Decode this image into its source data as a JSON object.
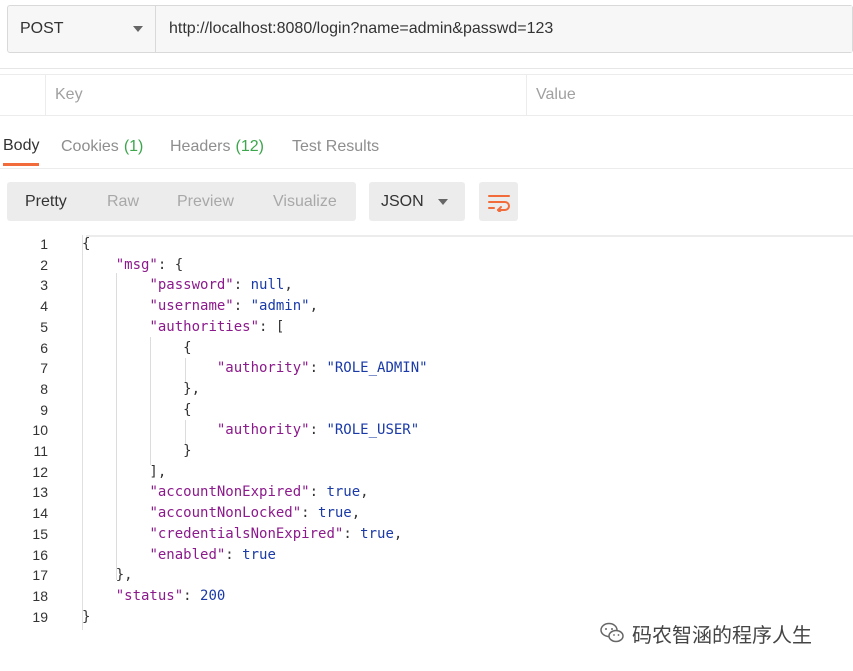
{
  "request": {
    "method": "POST",
    "url": "http://localhost:8080/login?name=admin&passwd=123"
  },
  "params": {
    "key_placeholder": "Key",
    "value_placeholder": "Value"
  },
  "response_tabs": [
    {
      "label": "Body",
      "count": ""
    },
    {
      "label": "Cookies",
      "count": "(1)"
    },
    {
      "label": "Headers",
      "count": "(12)"
    },
    {
      "label": "Test Results",
      "count": ""
    }
  ],
  "view_modes": [
    "Pretty",
    "Raw",
    "Preview",
    "Visualize"
  ],
  "language": "JSON",
  "colors": {
    "accent": "#f26b3a",
    "count": "#3ca64c",
    "key": "#8c1a8c",
    "value": "#1a3aa8"
  },
  "code": {
    "line_numbers": [
      "1",
      "2",
      "3",
      "4",
      "5",
      "6",
      "7",
      "8",
      "9",
      "10",
      "11",
      "12",
      "13",
      "14",
      "15",
      "16",
      "17",
      "18",
      "19"
    ],
    "lines": [
      [
        [
          "p",
          "{"
        ]
      ],
      [
        [
          "p",
          "    "
        ],
        [
          "k",
          "\"msg\""
        ],
        [
          "p",
          ": {"
        ]
      ],
      [
        [
          "p",
          "        "
        ],
        [
          "k",
          "\"password\""
        ],
        [
          "p",
          ": "
        ],
        [
          "l",
          "null"
        ],
        [
          "p",
          ","
        ]
      ],
      [
        [
          "p",
          "        "
        ],
        [
          "k",
          "\"username\""
        ],
        [
          "p",
          ": "
        ],
        [
          "s",
          "\"admin\""
        ],
        [
          "p",
          ","
        ]
      ],
      [
        [
          "p",
          "        "
        ],
        [
          "k",
          "\"authorities\""
        ],
        [
          "p",
          ": ["
        ]
      ],
      [
        [
          "p",
          "            {"
        ]
      ],
      [
        [
          "p",
          "                "
        ],
        [
          "k",
          "\"authority\""
        ],
        [
          "p",
          ": "
        ],
        [
          "s",
          "\"ROLE_ADMIN\""
        ]
      ],
      [
        [
          "p",
          "            },"
        ]
      ],
      [
        [
          "p",
          "            {"
        ]
      ],
      [
        [
          "p",
          "                "
        ],
        [
          "k",
          "\"authority\""
        ],
        [
          "p",
          ": "
        ],
        [
          "s",
          "\"ROLE_USER\""
        ]
      ],
      [
        [
          "p",
          "            }"
        ]
      ],
      [
        [
          "p",
          "        ],"
        ]
      ],
      [
        [
          "p",
          "        "
        ],
        [
          "k",
          "\"accountNonExpired\""
        ],
        [
          "p",
          ": "
        ],
        [
          "l",
          "true"
        ],
        [
          "p",
          ","
        ]
      ],
      [
        [
          "p",
          "        "
        ],
        [
          "k",
          "\"accountNonLocked\""
        ],
        [
          "p",
          ": "
        ],
        [
          "l",
          "true"
        ],
        [
          "p",
          ","
        ]
      ],
      [
        [
          "p",
          "        "
        ],
        [
          "k",
          "\"credentialsNonExpired\""
        ],
        [
          "p",
          ": "
        ],
        [
          "l",
          "true"
        ],
        [
          "p",
          ","
        ]
      ],
      [
        [
          "p",
          "        "
        ],
        [
          "k",
          "\"enabled\""
        ],
        [
          "p",
          ": "
        ],
        [
          "l",
          "true"
        ]
      ],
      [
        [
          "p",
          "    },"
        ]
      ],
      [
        [
          "p",
          "    "
        ],
        [
          "k",
          "\"status\""
        ],
        [
          "p",
          ": "
        ],
        [
          "l",
          "200"
        ]
      ],
      [
        [
          "p",
          "}"
        ]
      ]
    ]
  },
  "watermark": "码农智涵的程序人生"
}
